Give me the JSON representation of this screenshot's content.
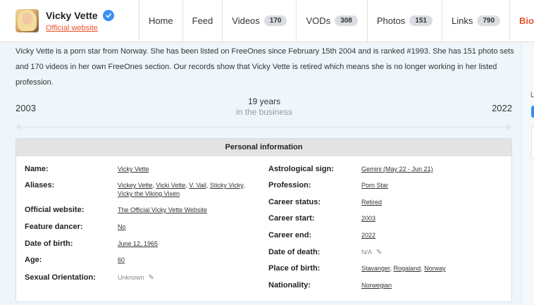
{
  "header": {
    "name": "Vicky Vette",
    "official_link": "Official website",
    "nav": [
      {
        "label": "Home",
        "count": null
      },
      {
        "label": "Feed",
        "count": null
      },
      {
        "label": "Videos",
        "count": "170"
      },
      {
        "label": "VODs",
        "count": "308"
      },
      {
        "label": "Photos",
        "count": "151"
      },
      {
        "label": "Links",
        "count": "790"
      },
      {
        "label": "Bio",
        "count": null
      }
    ]
  },
  "bio": {
    "text": "Vicky Vette is a porn star from Norway. She has been listed on FreeOnes since February 15th 2004 and is ranked #1993. She has 151 photo sets and 170 videos in her own FreeOnes section. Our records show that Vicky Vette is retired which means she is no longer working in her listed profession."
  },
  "timeline": {
    "start": "2003",
    "end": "2022",
    "duration": "19 years",
    "sub": "in the business"
  },
  "right_edge": {
    "letter": "L"
  },
  "personal": {
    "title": "Personal information",
    "left": [
      {
        "label": "Name:",
        "values": [
          "Vicky Vette"
        ]
      },
      {
        "label": "Aliases:",
        "line1": [
          "Vickey Vette",
          "Vicki Vette",
          "V. Vail",
          "Sticky Vicky"
        ],
        "line2": [
          "Vicky the Viking Vixen"
        ]
      },
      {
        "label": "Official website:",
        "values": [
          "The Official Vicky Vette Website"
        ]
      },
      {
        "label": "Feature dancer:",
        "values": [
          "No"
        ]
      },
      {
        "label": "Date of birth:",
        "values": [
          "June 12, 1965"
        ]
      },
      {
        "label": "Age:",
        "values": [
          "60"
        ]
      },
      {
        "label": "Sexual Orientation:",
        "values": [
          "Unknown"
        ]
      }
    ],
    "right": [
      {
        "label": "Astrological sign:",
        "values": [
          "Gemini (May 22 - Jun 21)"
        ]
      },
      {
        "label": "Profession:",
        "values": [
          "Porn Star"
        ]
      },
      {
        "label": "Career status:",
        "values": [
          "Retired"
        ]
      },
      {
        "label": "Career start:",
        "values": [
          "2003"
        ]
      },
      {
        "label": "Career end:",
        "values": [
          "2022"
        ]
      },
      {
        "label": "Date of death:",
        "values": [
          "N/A"
        ]
      },
      {
        "label": "Place of birth:",
        "values": [
          "Stavanger",
          "Rogaland",
          "Norway"
        ]
      },
      {
        "label": "Nationality:",
        "values": [
          "Norwegian"
        ]
      }
    ]
  }
}
